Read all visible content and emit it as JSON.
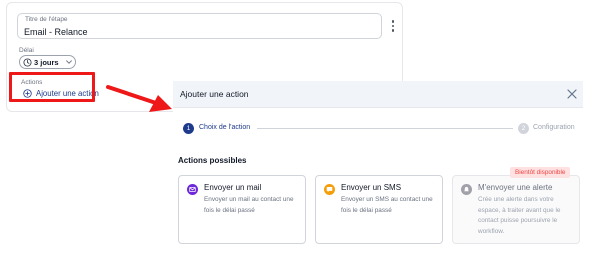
{
  "step_card": {
    "title_field": {
      "label": "Titre de l'étape",
      "value": "Email - Relance"
    },
    "delay": {
      "label": "Délai",
      "value": "3 jours"
    },
    "actions": {
      "label": "Actions",
      "add_link": "Ajouter une action"
    }
  },
  "modal": {
    "title": "Ajouter une action",
    "stepper": [
      {
        "number": "1",
        "label": "Choix de l'action"
      },
      {
        "number": "2",
        "label": "Configuration"
      }
    ],
    "section_title": "Actions possibles",
    "options": [
      {
        "title": "Envoyer un mail",
        "description": "Envoyer un mail au contact une fois le délai passé",
        "icon": "mail-icon",
        "color": "#6d28d9"
      },
      {
        "title": "Envoyer un SMS",
        "description": "Envoyer un SMS au contact une fois le délai passé",
        "icon": "sms-icon",
        "color": "#f59e0b"
      },
      {
        "title": "M'envoyer une alerte",
        "description": "Crée une alerte dans votre espace, à traiter avant que le contact puisse poursuivre le workflow.",
        "icon": "alert-icon",
        "color": "#a1a1aa",
        "badge": "Bientôt disponible"
      }
    ]
  },
  "colors": {
    "accent": "#1e3a8a",
    "annotation": "#ef1818",
    "badge_bg": "#fee2e2",
    "badge_text": "#ef4444"
  }
}
